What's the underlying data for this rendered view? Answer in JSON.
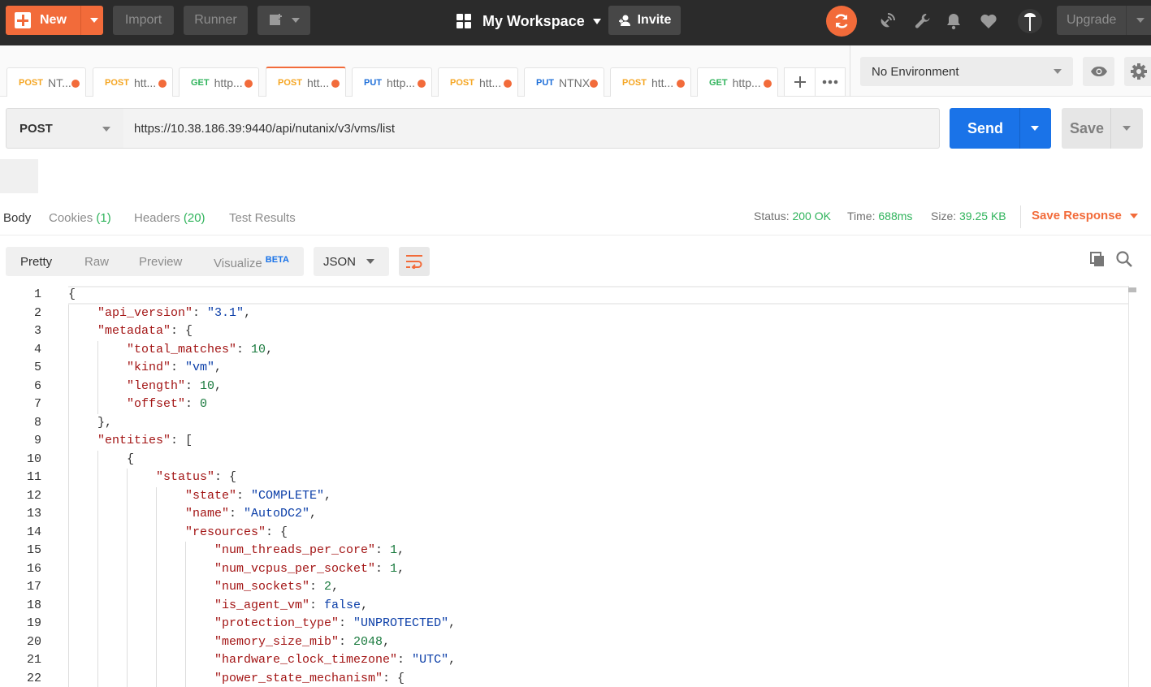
{
  "topbar": {
    "new_label": "New",
    "import_label": "Import",
    "runner_label": "Runner",
    "workspace_label": "My Workspace",
    "invite_label": "Invite",
    "upgrade_label": "Upgrade"
  },
  "tabs": [
    {
      "method": "POST",
      "title": "NT...",
      "color": "#f5a623"
    },
    {
      "method": "POST",
      "title": "htt...",
      "color": "#f5a623"
    },
    {
      "method": "GET",
      "title": "http...",
      "color": "#2fb35b"
    },
    {
      "method": "POST",
      "title": "htt...",
      "color": "#f5a623",
      "active": true
    },
    {
      "method": "PUT",
      "title": "http...",
      "color": "#1e6fd9"
    },
    {
      "method": "POST",
      "title": "htt...",
      "color": "#f5a623"
    },
    {
      "method": "PUT",
      "title": "NTNX",
      "color": "#1e6fd9"
    },
    {
      "method": "POST",
      "title": "htt...",
      "color": "#f5a623"
    },
    {
      "method": "GET",
      "title": "http...",
      "color": "#2fb35b"
    }
  ],
  "environment": {
    "selected": "No Environment"
  },
  "request": {
    "method": "POST",
    "url": "https://10.38.186.39:9440/api/nutanix/v3/vms/list",
    "send_label": "Send",
    "save_label": "Save"
  },
  "response_tabs": {
    "body": "Body",
    "cookies": "Cookies",
    "cookies_count": "(1)",
    "headers": "Headers",
    "headers_count": "(20)",
    "tests": "Test Results"
  },
  "response_status": {
    "status_label": "Status:",
    "status_value": "200 OK",
    "time_label": "Time:",
    "time_value": "688ms",
    "size_label": "Size:",
    "size_value": "39.25 KB",
    "save_response": "Save Response"
  },
  "body_view": {
    "pretty": "Pretty",
    "raw": "Raw",
    "preview": "Preview",
    "visualize": "Visualize",
    "beta": "BETA",
    "format": "JSON"
  },
  "code_lines": [
    [
      {
        "t": "p",
        "v": "{"
      }
    ],
    [
      {
        "t": "k",
        "v": "\"api_version\""
      },
      {
        "t": "p",
        "v": ": "
      },
      {
        "t": "s",
        "v": "\"3.1\""
      },
      {
        "t": "p",
        "v": ","
      }
    ],
    [
      {
        "t": "k",
        "v": "\"metadata\""
      },
      {
        "t": "p",
        "v": ": {"
      }
    ],
    [
      {
        "t": "k",
        "v": "\"total_matches\""
      },
      {
        "t": "p",
        "v": ": "
      },
      {
        "t": "n",
        "v": "10"
      },
      {
        "t": "p",
        "v": ","
      }
    ],
    [
      {
        "t": "k",
        "v": "\"kind\""
      },
      {
        "t": "p",
        "v": ": "
      },
      {
        "t": "s",
        "v": "\"vm\""
      },
      {
        "t": "p",
        "v": ","
      }
    ],
    [
      {
        "t": "k",
        "v": "\"length\""
      },
      {
        "t": "p",
        "v": ": "
      },
      {
        "t": "n",
        "v": "10"
      },
      {
        "t": "p",
        "v": ","
      }
    ],
    [
      {
        "t": "k",
        "v": "\"offset\""
      },
      {
        "t": "p",
        "v": ": "
      },
      {
        "t": "n",
        "v": "0"
      }
    ],
    [
      {
        "t": "p",
        "v": "},"
      }
    ],
    [
      {
        "t": "k",
        "v": "\"entities\""
      },
      {
        "t": "p",
        "v": ": ["
      }
    ],
    [
      {
        "t": "p",
        "v": "{"
      }
    ],
    [
      {
        "t": "k",
        "v": "\"status\""
      },
      {
        "t": "p",
        "v": ": {"
      }
    ],
    [
      {
        "t": "k",
        "v": "\"state\""
      },
      {
        "t": "p",
        "v": ": "
      },
      {
        "t": "s",
        "v": "\"COMPLETE\""
      },
      {
        "t": "p",
        "v": ","
      }
    ],
    [
      {
        "t": "k",
        "v": "\"name\""
      },
      {
        "t": "p",
        "v": ": "
      },
      {
        "t": "s",
        "v": "\"AutoDC2\""
      },
      {
        "t": "p",
        "v": ","
      }
    ],
    [
      {
        "t": "k",
        "v": "\"resources\""
      },
      {
        "t": "p",
        "v": ": {"
      }
    ],
    [
      {
        "t": "k",
        "v": "\"num_threads_per_core\""
      },
      {
        "t": "p",
        "v": ": "
      },
      {
        "t": "n",
        "v": "1"
      },
      {
        "t": "p",
        "v": ","
      }
    ],
    [
      {
        "t": "k",
        "v": "\"num_vcpus_per_socket\""
      },
      {
        "t": "p",
        "v": ": "
      },
      {
        "t": "n",
        "v": "1"
      },
      {
        "t": "p",
        "v": ","
      }
    ],
    [
      {
        "t": "k",
        "v": "\"num_sockets\""
      },
      {
        "t": "p",
        "v": ": "
      },
      {
        "t": "n",
        "v": "2"
      },
      {
        "t": "p",
        "v": ","
      }
    ],
    [
      {
        "t": "k",
        "v": "\"is_agent_vm\""
      },
      {
        "t": "p",
        "v": ": "
      },
      {
        "t": "b",
        "v": "false"
      },
      {
        "t": "p",
        "v": ","
      }
    ],
    [
      {
        "t": "k",
        "v": "\"protection_type\""
      },
      {
        "t": "p",
        "v": ": "
      },
      {
        "t": "s",
        "v": "\"UNPROTECTED\""
      },
      {
        "t": "p",
        "v": ","
      }
    ],
    [
      {
        "t": "k",
        "v": "\"memory_size_mib\""
      },
      {
        "t": "p",
        "v": ": "
      },
      {
        "t": "n",
        "v": "2048"
      },
      {
        "t": "p",
        "v": ","
      }
    ],
    [
      {
        "t": "k",
        "v": "\"hardware_clock_timezone\""
      },
      {
        "t": "p",
        "v": ": "
      },
      {
        "t": "s",
        "v": "\"UTC\""
      },
      {
        "t": "p",
        "v": ","
      }
    ],
    [
      {
        "t": "k",
        "v": "\"power_state_mechanism\""
      },
      {
        "t": "p",
        "v": ": {"
      }
    ]
  ],
  "code_line_numbers": [
    "1",
    "2",
    "3",
    "4",
    "5",
    "6",
    "7",
    "8",
    "9",
    "10",
    "11",
    "12",
    "13",
    "14",
    "15",
    "16",
    "17",
    "18",
    "19",
    "20",
    "21",
    "22"
  ],
  "icons": {
    "builder": "new-window-icon",
    "sync": "sync-icon",
    "satellite": "satellite-icon",
    "wrench": "wrench-icon",
    "bell": "bell-icon",
    "heart": "heart-icon",
    "avatar": "avatar-icon",
    "eye": "eye-icon",
    "gear": "gear-icon",
    "copy": "copy-icon",
    "search": "search-icon",
    "wrap": "wrap-lines-icon"
  },
  "colors": {
    "accent": "#f26b3a",
    "send": "#1a73e8",
    "success": "#2fb35b"
  }
}
